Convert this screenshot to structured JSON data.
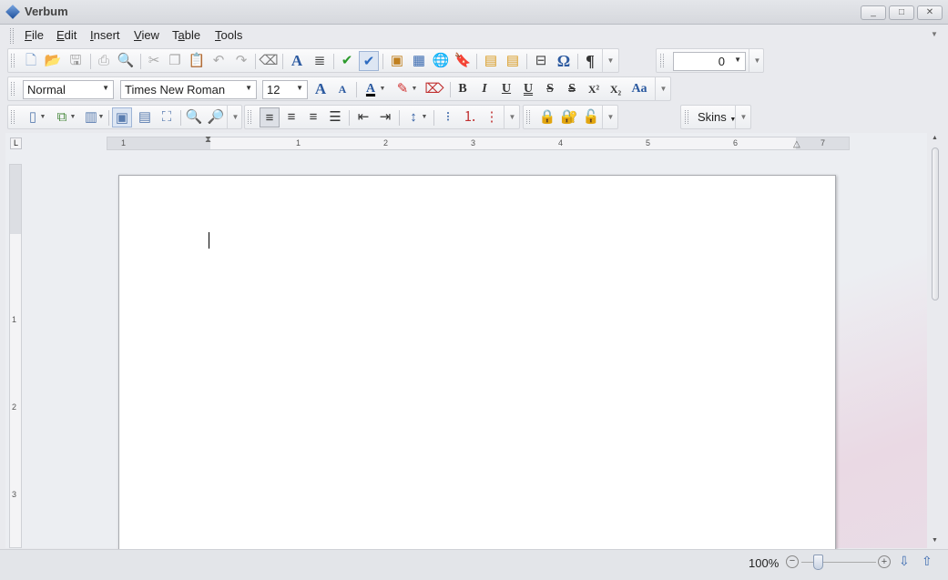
{
  "window": {
    "title": "Verbum",
    "minimize": "_",
    "maximize": "□",
    "close": "✕"
  },
  "menu": [
    {
      "key": "F",
      "rest": "ile"
    },
    {
      "key": "E",
      "rest": "dit"
    },
    {
      "key": "I",
      "rest": "nsert"
    },
    {
      "key": "V",
      "rest": "iew"
    },
    {
      "pre": "T",
      "key": "a",
      "rest": "ble"
    },
    {
      "key": "T",
      "rest": "ools"
    }
  ],
  "toolbar": {
    "style": "Normal",
    "font": "Times New Roman",
    "size": "12",
    "spacing_value": "0",
    "bold": "B",
    "italic": "I",
    "underline": "U",
    "double_underline": "U",
    "strike": "S",
    "double_strike": "S",
    "superscript": "X²",
    "subscript": "X₂",
    "change_case": "Aa",
    "skins": "Skins"
  },
  "ruler": {
    "h": [
      "1",
      "1",
      "2",
      "3",
      "4",
      "5",
      "6",
      "7"
    ],
    "v": [
      "1",
      "2",
      "3"
    ]
  },
  "status": {
    "zoom": "100%"
  }
}
